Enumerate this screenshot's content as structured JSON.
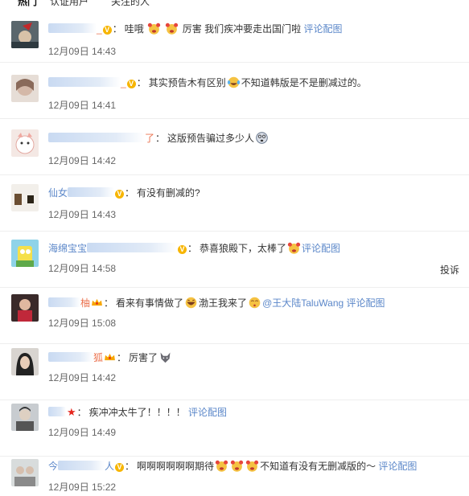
{
  "tabs": [
    "热门",
    "认证用户",
    "关注的人"
  ],
  "comments": [
    {
      "user_prefix": "",
      "user_suffix": "_",
      "badge": "V",
      "text": "哇哦",
      "text2": "厉害 我们疾冲要走出国门啦",
      "action": "评论配图",
      "time": "12月09日 14:43"
    },
    {
      "user_prefix": "",
      "user_suffix": "_",
      "badge": "V",
      "text": "其实预告木有区别",
      "text2": "不知道韩版是不是删减过的。",
      "action": "",
      "time": "12月09日 14:41"
    },
    {
      "user_prefix": "",
      "user_suffix": "了",
      "badge": "",
      "text": "这版预告骗过多少人",
      "text2": "",
      "action": "",
      "time": "12月09日 14:42"
    },
    {
      "user_prefix": "仙女",
      "user_suffix": "",
      "badge": "V",
      "text": "有没有删减的?",
      "text2": "",
      "action": "",
      "time": "12月09日 14:43"
    },
    {
      "user_prefix": "海绵宝宝",
      "user_suffix": "",
      "badge": "V",
      "text": "恭喜狼殿下，太棒了",
      "text2": "",
      "action": "评论配图",
      "time": "12月09日 14:58",
      "report": "投诉"
    },
    {
      "user_prefix": "",
      "user_suffix": "柚",
      "badge": "crown",
      "text": "看来有事情做了",
      "text2": "渤王我来了",
      "mention": "@王大陆TaluWang",
      "action": "评论配图",
      "time": "12月09日 15:08"
    },
    {
      "user_prefix": "",
      "user_suffix": "狐",
      "badge": "crown",
      "text": "厉害了",
      "text2": "",
      "action": "",
      "time": "12月09日 14:42"
    },
    {
      "user_prefix": "",
      "user_suffix": "",
      "badge": "star",
      "text": "疾冲冲太牛了！！！！",
      "text2": "",
      "action": "评论配图",
      "time": "12月09日 14:49"
    },
    {
      "user_prefix": "今",
      "user_suffix": "人",
      "badge": "V",
      "text": "啊啊啊啊啊啊期待",
      "text2": "不知道有没有无删减版的～",
      "action": "评论配图",
      "time": "12月09日 15:22"
    }
  ],
  "colors": {
    "link": "#5b87c9",
    "username": "#eb7350",
    "vip_badge": "#f7b500",
    "star": "#e5261e"
  }
}
